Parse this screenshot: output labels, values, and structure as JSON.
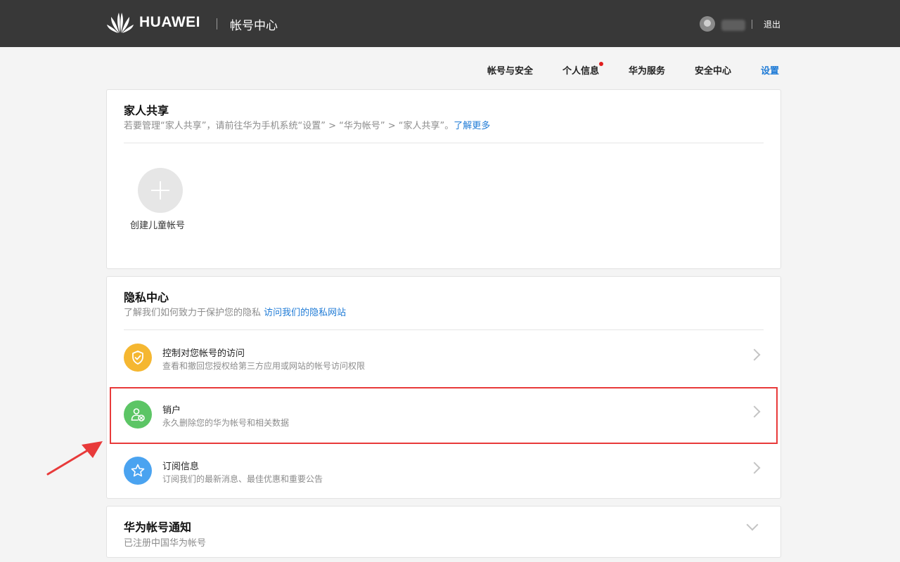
{
  "header": {
    "brand": "HUAWEI",
    "title": "帐号中心",
    "logout": "退出"
  },
  "nav": {
    "items": [
      {
        "label": "帐号与安全"
      },
      {
        "label": "个人信息",
        "has_dot": true
      },
      {
        "label": "华为服务"
      },
      {
        "label": "安全中心"
      },
      {
        "label": "设置",
        "active": true
      }
    ]
  },
  "family_sharing": {
    "title": "家人共享",
    "subtitle": "若要管理“家人共享”，请前往华为手机系统“设置” > “华为帐号” > “家人共享”。",
    "link": "了解更多",
    "add_label": "创建儿童帐号"
  },
  "privacy": {
    "title": "隐私中心",
    "subtitle": "了解我们如何致力于保护您的隐私",
    "link": "访问我们的隐私网站",
    "rows": [
      {
        "title": "控制对您帐号的访问",
        "desc": "查看和撤回您授权给第三方应用或网站的帐号访问权限",
        "icon": "shield-check-icon",
        "color": "#f5b731"
      },
      {
        "title": "销户",
        "desc": "永久删除您的华为帐号和相关数据",
        "icon": "user-delete-icon",
        "color": "#5cc565"
      },
      {
        "title": "订阅信息",
        "desc": "订阅我们的最新消息、最佳优惠和重要公告",
        "icon": "star-icon",
        "color": "#4aa3f0"
      }
    ]
  },
  "notice": {
    "title": "华为帐号通知",
    "subtitle": "已注册中国华为帐号"
  },
  "colors": {
    "header_bg": "#383838",
    "accent": "#1f7bd6",
    "highlight": "#e83a3a"
  }
}
